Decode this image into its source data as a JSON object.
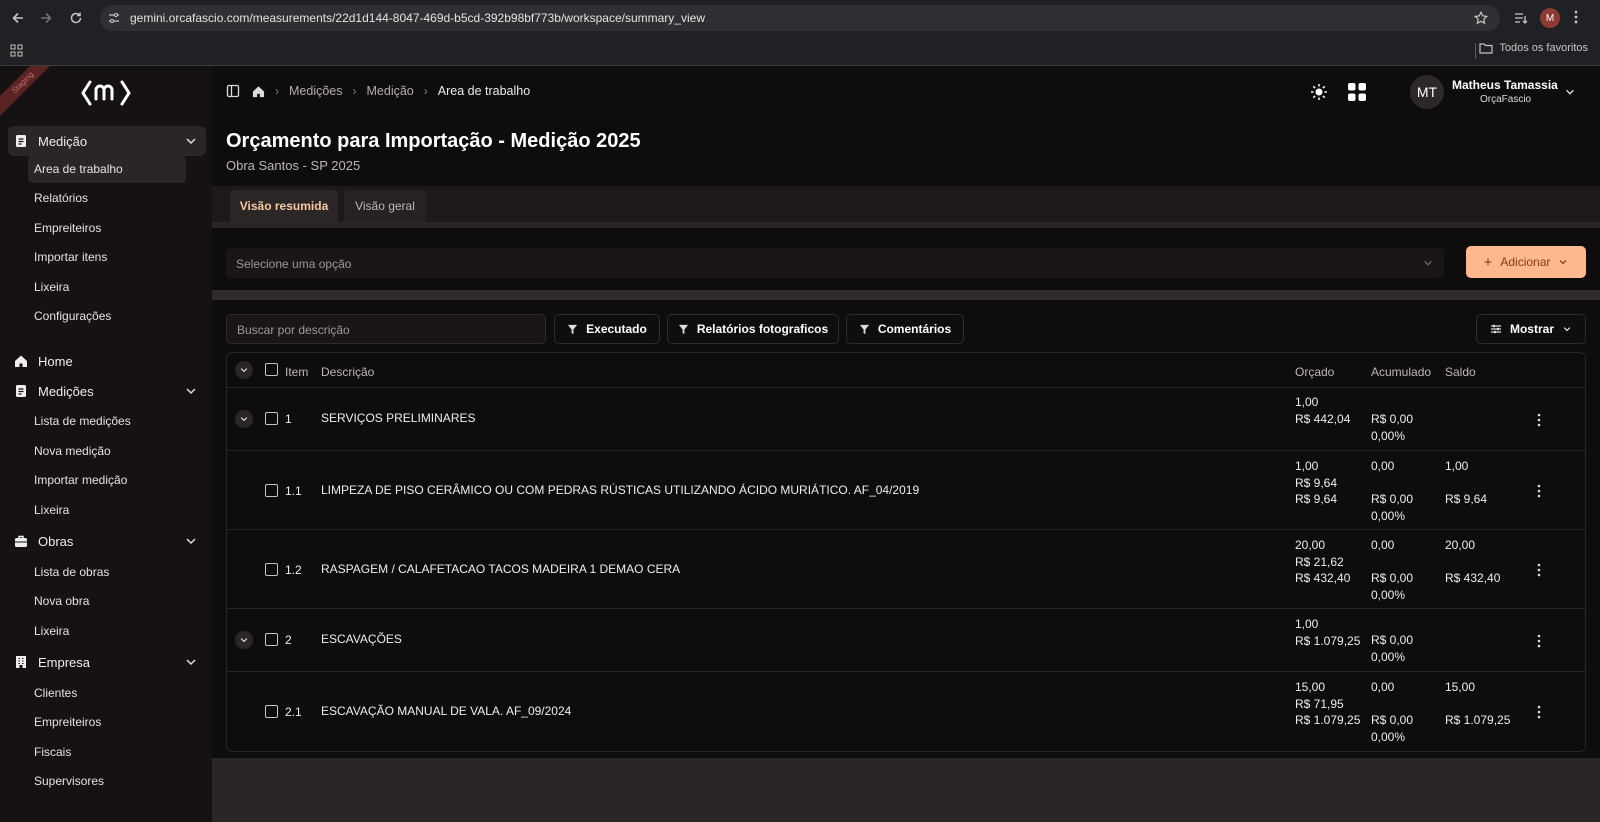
{
  "browser": {
    "url": "gemini.orcafascio.com/measurements/22d1d144-8047-469d-b5cd-392b98bf773b/workspace/summary_view",
    "profile_initial": "M",
    "bookmarks_all": "Todos os favoritos"
  },
  "sidebar": {
    "ribbon": "Staging",
    "groups": [
      {
        "label": "Medição",
        "items": [
          "Area de trabalho",
          "Relatórios",
          "Empreiteiros",
          "Importar itens",
          "Lixeira",
          "Configurações"
        ]
      },
      {
        "label": "Home"
      },
      {
        "label": "Medições",
        "items": [
          "Lista de medições",
          "Nova medição",
          "Importar medição",
          "Lixeira"
        ]
      },
      {
        "label": "Obras",
        "items": [
          "Lista de obras",
          "Nova obra",
          "Lixeira"
        ]
      },
      {
        "label": "Empresa",
        "items": [
          "Clientes",
          "Empreiteiros",
          "Fiscais",
          "Supervisores"
        ]
      }
    ]
  },
  "header": {
    "breadcrumb": [
      "Medições",
      "Medição",
      "Area de trabalho"
    ],
    "user": {
      "initials": "MT",
      "name": "Matheus Tamassia",
      "org": "OrçaFascio"
    }
  },
  "page": {
    "title": "Orçamento para Importação - Medição 2025",
    "subtitle": "Obra Santos - SP 2025",
    "tabs": [
      "Visão resumida",
      "Visão geral"
    ],
    "active_tab": "Visão resumida",
    "select_placeholder": "Selecione uma opção",
    "add_label": "Adicionar",
    "search_placeholder": "Buscar por descrição",
    "filters": [
      "Executado",
      "Relatórios fotograficos",
      "Comentários"
    ],
    "show_label": "Mostrar"
  },
  "colors": {
    "accent": "#fdb98b",
    "accent_text": "#8a3a12",
    "active_tab_text": "#f6c8a4"
  },
  "table": {
    "headers": {
      "item": "Item",
      "descricao": "Descrição",
      "orcado": "Orçado",
      "acumulado": "Acumulado",
      "saldo": "Saldo"
    },
    "rows": [
      {
        "item": "1",
        "descricao": "SERVIÇOS PRELIMINARES",
        "orcado": [
          "1,00",
          "R$ 442,04"
        ],
        "acumulado": [
          "R$ 0,00",
          "0,00%"
        ],
        "saldo": []
      },
      {
        "item": "1.1",
        "descricao": "LIMPEZA DE PISO CERÂMICO OU COM PEDRAS RÚSTICAS UTILIZANDO ÁCIDO MURIÁTICO. AF_04/2019",
        "orcado": [
          "1,00",
          "R$ 9,64",
          "R$ 9,64"
        ],
        "acumulado": [
          "0,00",
          "",
          "R$ 0,00",
          "0,00%"
        ],
        "saldo": [
          "1,00",
          "",
          "R$ 9,64"
        ]
      },
      {
        "item": "1.2",
        "descricao": "RASPAGEM / CALAFETACAO TACOS MADEIRA 1 DEMAO CERA",
        "orcado": [
          "20,00",
          "R$ 21,62",
          "R$ 432,40"
        ],
        "acumulado": [
          "0,00",
          "",
          "R$ 0,00",
          "0,00%"
        ],
        "saldo": [
          "20,00",
          "",
          "R$ 432,40"
        ]
      },
      {
        "item": "2",
        "descricao": "ESCAVAÇÕES",
        "orcado": [
          "1,00",
          "R$ 1.079,25"
        ],
        "acumulado": [
          "R$ 0,00",
          "0,00%"
        ],
        "saldo": []
      },
      {
        "item": "2.1",
        "descricao": "ESCAVAÇÃO MANUAL DE VALA. AF_09/2024",
        "orcado": [
          "15,00",
          "R$ 71,95",
          "R$ 1.079,25"
        ],
        "acumulado": [
          "0,00",
          "",
          "R$ 0,00",
          "0,00%"
        ],
        "saldo": [
          "15,00",
          "",
          "R$ 1.079,25"
        ]
      }
    ]
  }
}
